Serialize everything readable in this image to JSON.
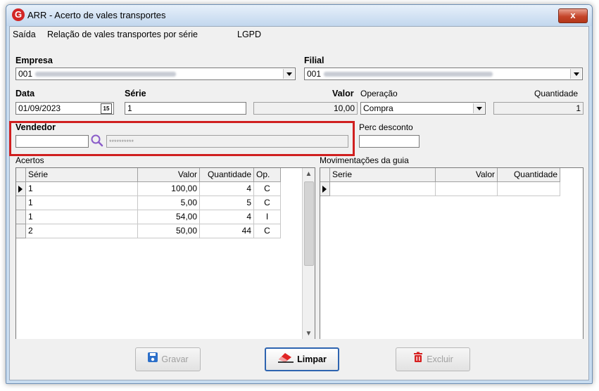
{
  "window": {
    "title": "ARR - Acerto de vales transportes",
    "close_glyph": "x",
    "logo_letter": "G"
  },
  "menu": {
    "saida": "Saída",
    "relacao": "Relação de vales transportes por série",
    "lgpd": "LGPD"
  },
  "form": {
    "empresa_label": "Empresa",
    "empresa_value": "001",
    "filial_label": "Filial",
    "filial_value": "001",
    "data_label": "Data",
    "data_value": "01/09/2023",
    "calendar_glyph": "15",
    "serie_label": "Série",
    "serie_value": "1",
    "valor_label": "Valor",
    "valor_value": "10,00",
    "operacao_label": "Operação",
    "operacao_value": "Compra",
    "quantidade_label": "Quantidade",
    "quantidade_value": "1",
    "vendedor_label": "Vendedor",
    "vendedor_value": "",
    "vendedor_name": "**********",
    "perc_desconto_label": "Perc desconto",
    "perc_desconto_value": ""
  },
  "acertos": {
    "title": "Acertos",
    "columns": [
      "Série",
      "Valor",
      "Quantidade",
      "Op."
    ],
    "rows": [
      {
        "serie": "1",
        "valor": "100,00",
        "quantidade": "4",
        "op": "C"
      },
      {
        "serie": "1",
        "valor": "5,00",
        "quantidade": "5",
        "op": "C"
      },
      {
        "serie": "1",
        "valor": "54,00",
        "quantidade": "4",
        "op": "I"
      },
      {
        "serie": "2",
        "valor": "50,00",
        "quantidade": "44",
        "op": "C"
      }
    ]
  },
  "movimentacoes": {
    "title": "Movimentações da guia",
    "columns": [
      "Serie",
      "Valor",
      "Quantidade"
    ]
  },
  "buttons": {
    "gravar": "Gravar",
    "limpar": "Limpar",
    "excluir": "Excluir"
  },
  "icons": {
    "search": "search-icon",
    "save": "floppy-disk-icon",
    "eraser": "eraser-icon",
    "delete": "trash-icon"
  },
  "colors": {
    "highlight": "#d01f1f",
    "save_icon": "#2c6fc9",
    "eraser_icon": "#e02424",
    "trash_icon": "#d62020"
  }
}
